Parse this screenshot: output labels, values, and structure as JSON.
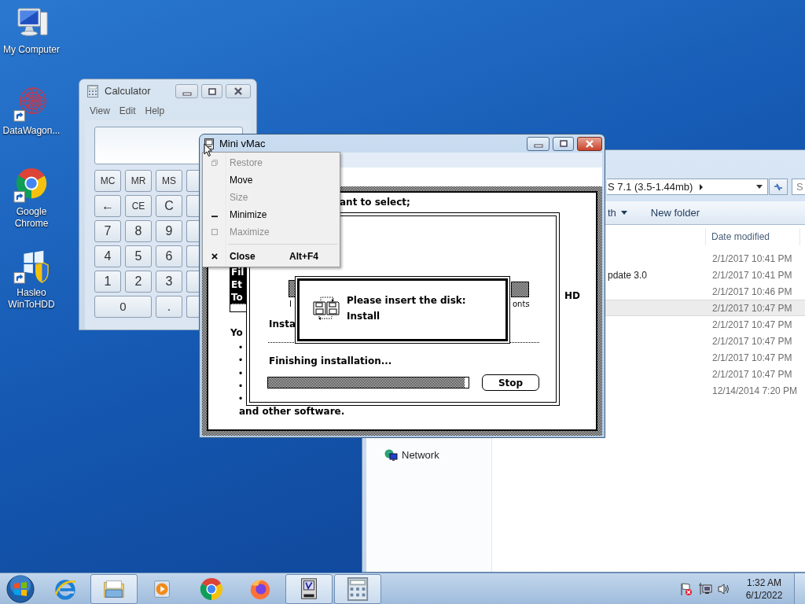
{
  "desktop_icons": [
    {
      "label": "My Computer",
      "kind": "computer",
      "shortcut": false
    },
    {
      "label": "DataWagon...",
      "kind": "sphere",
      "shortcut": true
    },
    {
      "label": "Google Chrome",
      "kind": "chrome",
      "shortcut": true
    },
    {
      "label": "Hasleo WinToHDD",
      "kind": "winshield",
      "shortcut": true
    }
  ],
  "calculator": {
    "title": "Calculator",
    "menu": [
      "View",
      "Edit",
      "Help"
    ],
    "keys": [
      [
        {
          "label": "MC"
        },
        {
          "label": "MR"
        },
        {
          "label": "MS"
        }
      ],
      [
        {
          "label": "←"
        },
        {
          "label": "CE"
        },
        {
          "label": "C"
        }
      ],
      [
        {
          "label": "7"
        },
        {
          "label": "8"
        },
        {
          "label": "9"
        }
      ],
      [
        {
          "label": "4"
        },
        {
          "label": "5"
        },
        {
          "label": "6"
        }
      ],
      [
        {
          "label": "1"
        },
        {
          "label": "2"
        },
        {
          "label": "3"
        }
      ],
      [
        {
          "label": "0",
          "wide": true
        },
        {
          "label": "."
        }
      ]
    ]
  },
  "explorer": {
    "address": "S 7.1 (3.5-1.44mb)",
    "search_placeholder": "S",
    "toolbar": [
      {
        "label": "th",
        "dropdown": true
      },
      {
        "label": "New folder",
        "dropdown": false
      }
    ],
    "columns": [
      "Date modified"
    ],
    "rows": [
      {
        "date": "2/1/2017 10:41 PM",
        "selected": false
      },
      {
        "name": "pdate 3.0",
        "date": "2/1/2017 10:41 PM",
        "selected": false
      },
      {
        "date": "2/1/2017 10:46 PM",
        "selected": false
      },
      {
        "date": "2/1/2017 10:47 PM",
        "selected": true
      },
      {
        "date": "2/1/2017 10:47 PM",
        "selected": false
      },
      {
        "date": "2/1/2017 10:47 PM",
        "selected": false
      },
      {
        "date": "2/1/2017 10:47 PM",
        "selected": false
      },
      {
        "date": "2/1/2017 10:47 PM",
        "selected": false
      },
      {
        "date": "12/14/2014 7:20 PM",
        "selected": false
      }
    ],
    "nav": [
      "Network"
    ]
  },
  "mini_vmac": {
    "title": "Mini vMac",
    "system_menu": [
      {
        "kind": "restore",
        "label": "Restore",
        "disabled": true,
        "default": false
      },
      {
        "kind": "move",
        "label": "Move",
        "disabled": false,
        "default": false
      },
      {
        "kind": "size",
        "label": "Size",
        "disabled": true,
        "default": false
      },
      {
        "kind": "minimize",
        "label": "Minimize",
        "disabled": false,
        "default": false
      },
      {
        "kind": "maximize",
        "label": "Maximize",
        "disabled": true,
        "default": false
      },
      {
        "kind": "separator"
      },
      {
        "kind": "close",
        "label": "Close",
        "shortcut": "Alt+F4",
        "disabled": false,
        "default": true
      }
    ],
    "installer": {
      "prompt": "ant to select;",
      "list": [
        {
          "label": "Fil",
          "selected": true
        },
        {
          "label": "Et",
          "selected": true
        },
        {
          "label": "To",
          "selected": true
        }
      ],
      "intro": "Yo",
      "bullets": [
        "•",
        "•",
        "•",
        "•",
        "•"
      ],
      "footer": "and other software.",
      "disk_label": "HD"
    },
    "progress_dialog": {
      "item_labels": [
        "I",
        "onts"
      ],
      "heading": "Insta",
      "status": "Finishing installation...",
      "level": 0.98,
      "button": "Stop"
    },
    "disk_dialog": {
      "message": "Please insert the disk:",
      "disk": "Install"
    }
  },
  "taskbar": {
    "apps": [
      {
        "kind": "ie",
        "open": false
      },
      {
        "kind": "explorer",
        "open": true
      },
      {
        "kind": "media",
        "open": false
      },
      {
        "kind": "chrome",
        "open": false
      },
      {
        "kind": "firefox",
        "open": false
      },
      {
        "kind": "vmac",
        "open": true
      },
      {
        "kind": "calculator",
        "open": true
      }
    ],
    "time": "1:32 AM",
    "date": "6/1/2022"
  }
}
